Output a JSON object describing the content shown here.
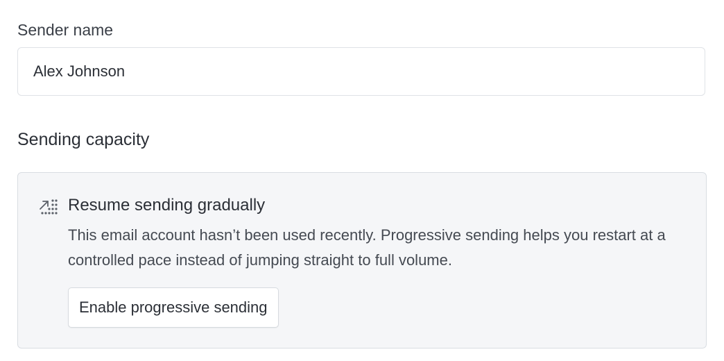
{
  "sender": {
    "label": "Sender name",
    "value": "Alex Johnson"
  },
  "capacity": {
    "title": "Sending capacity",
    "notice": {
      "icon": "progressive-ramp-icon",
      "title": "Resume sending gradually",
      "text": "This email account hasn’t been used recently. Progressive sending helps you restart at a controlled pace instead of jumping straight to full volume.",
      "button_label": "Enable progressive sending"
    }
  },
  "colors": {
    "text": "#2b2f36",
    "muted_text": "#454a52",
    "notice_bg": "#f5f6f8",
    "border": "#dfe2e6"
  }
}
